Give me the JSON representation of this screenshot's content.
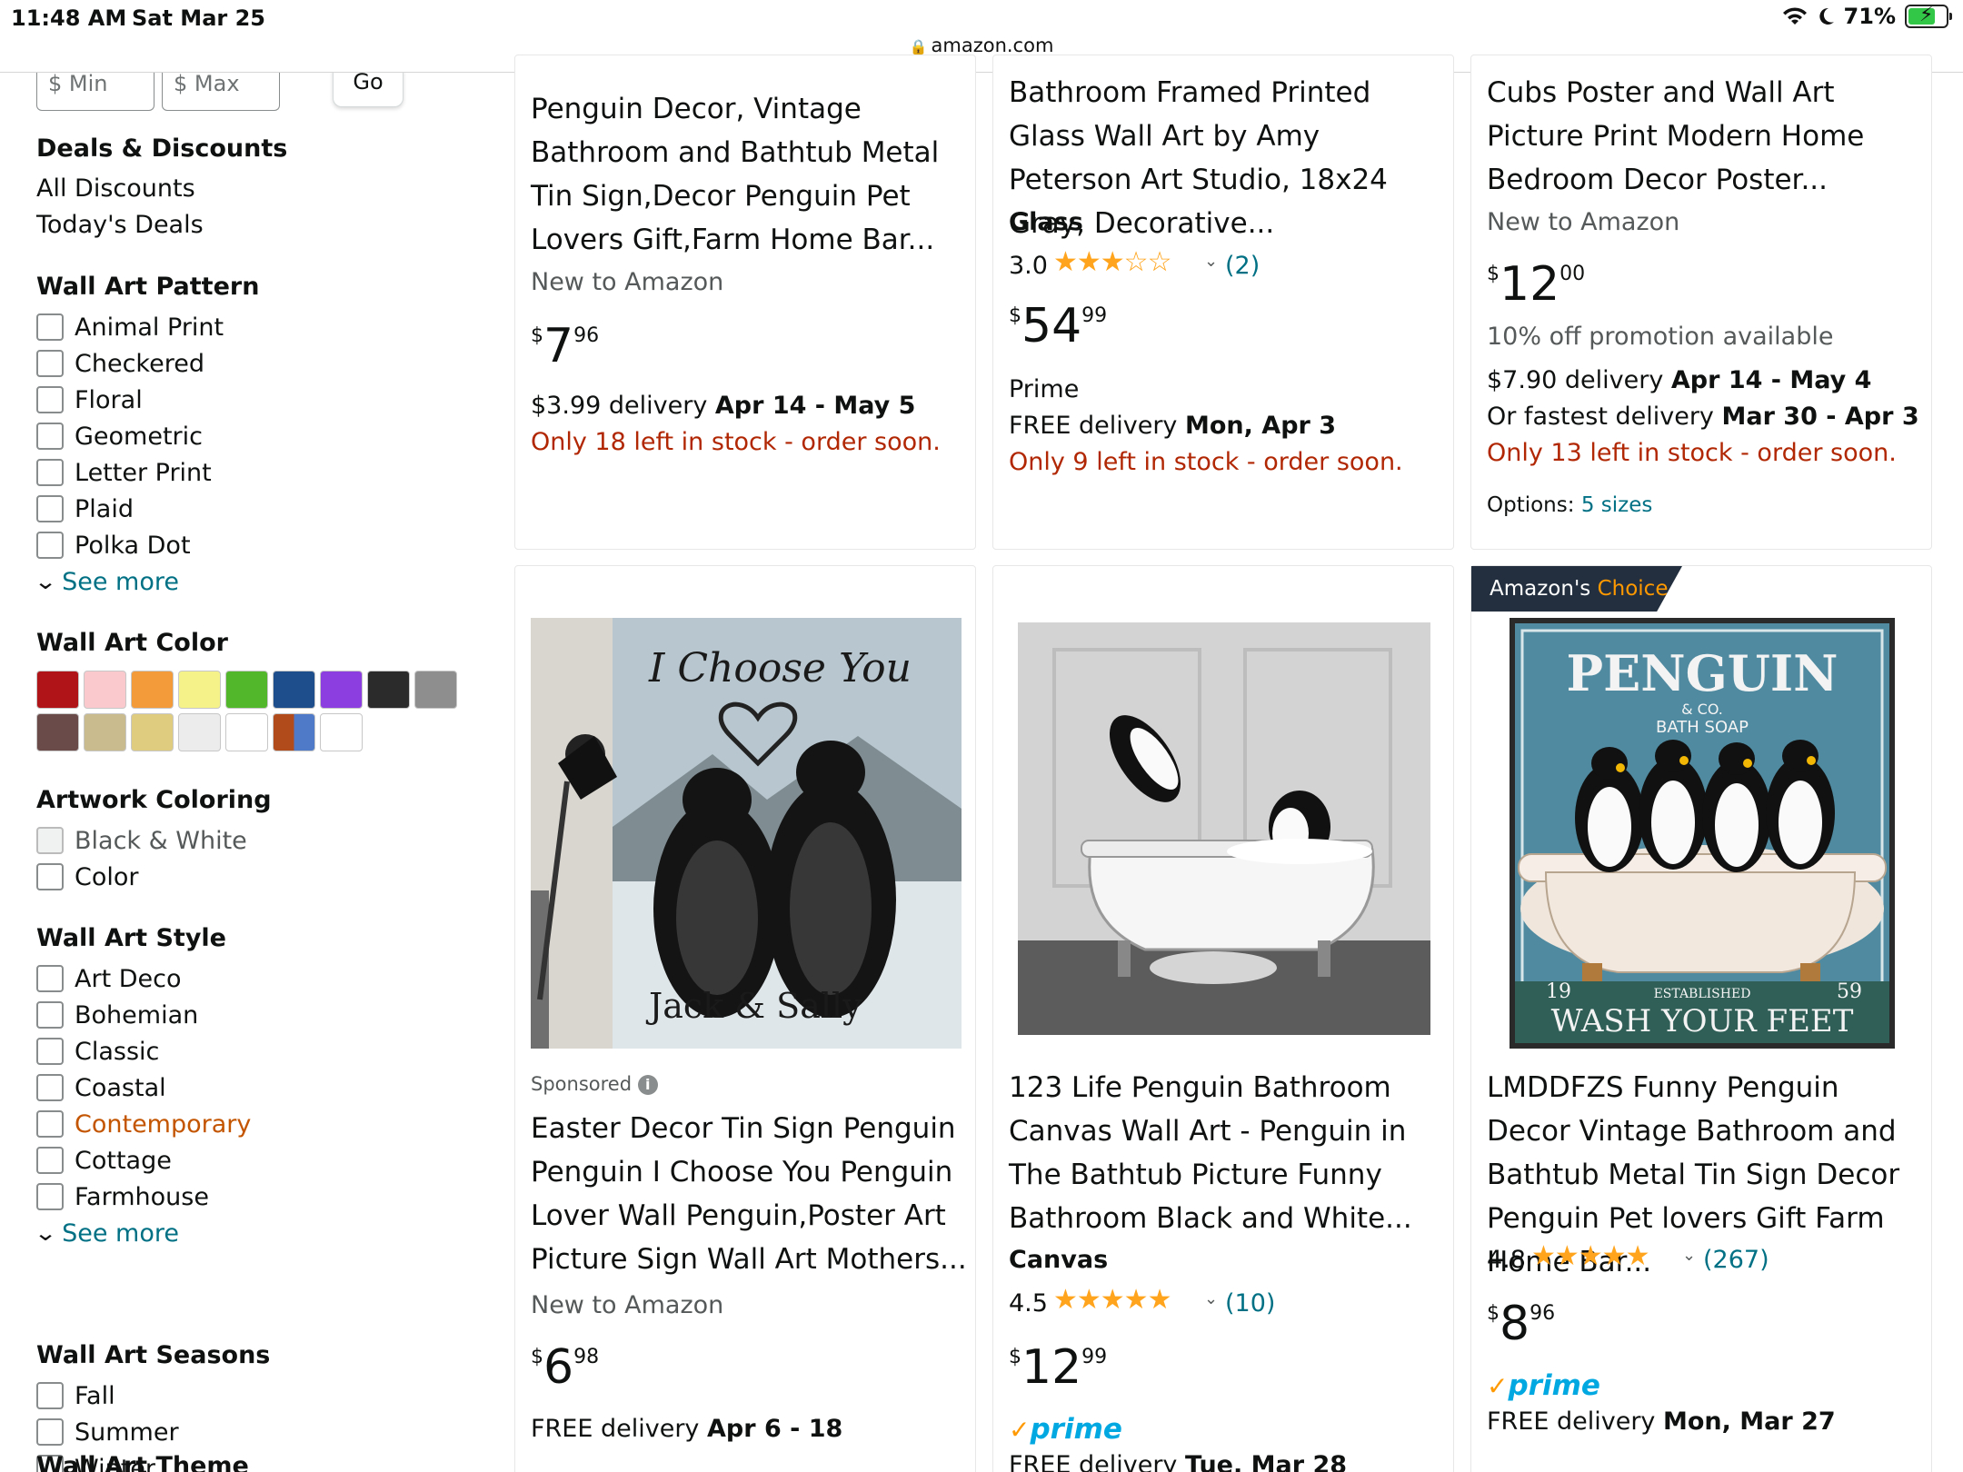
{
  "status_bar": {
    "time": "11:48 AM",
    "date": "Sat Mar 25",
    "battery": "71%",
    "url": "amazon.com"
  },
  "sidebar": {
    "price": {
      "min_placeholder": "$ Min",
      "max_placeholder": "$ Max",
      "go": "Go"
    },
    "deals": {
      "title": "Deals & Discounts",
      "items": [
        "All Discounts",
        "Today's Deals"
      ]
    },
    "pattern": {
      "title": "Wall Art Pattern",
      "items": [
        "Animal Print",
        "Checkered",
        "Floral",
        "Geometric",
        "Letter Print",
        "Plaid",
        "Polka Dot"
      ],
      "see_more": "See more"
    },
    "color": {
      "title": "Wall Art Color",
      "swatches": [
        "#b01318",
        "#f9c9cd",
        "#f39a3b",
        "#f5f28a",
        "#52b72a",
        "#1f4e8c",
        "#8c3ee0",
        "#2b2b2b",
        "#8e8e8e",
        "#6b4a4a",
        "#c9bb8e",
        "#dfcc7f",
        "#ececec",
        "#ffffff",
        "multi",
        "#ffffff"
      ]
    },
    "coloring": {
      "title": "Artwork Coloring",
      "items": [
        "Black & White",
        "Color"
      ]
    },
    "style": {
      "title": "Wall Art Style",
      "items": [
        "Art Deco",
        "Bohemian",
        "Classic",
        "Coastal",
        "Contemporary",
        "Cottage",
        "Farmhouse"
      ],
      "see_more": "See more"
    },
    "seasons": {
      "title": "Wall Art Seasons",
      "items": [
        "Fall",
        "Summer",
        "Winter"
      ]
    },
    "theme": {
      "title": "Wall Art Theme"
    }
  },
  "products": {
    "p1": {
      "title": "Penguin Decor, Vintage Bathroom and Bathtub Metal Tin Sign,Decor Penguin Pet Lovers Gift,Farm Home Bar...",
      "new": "New to Amazon",
      "price_cur": "$",
      "price_whole": "7",
      "price_frac": "96",
      "delivery_prefix": "$3.99 delivery ",
      "delivery_date": "Apr 14 - May 5",
      "stock": "Only 18 left in stock - order soon."
    },
    "p2": {
      "title": "Bathroom Framed Printed Glass Wall Art by Amy Peterson Art Studio, 18x24 Gray, Decorative...",
      "format": "Glass",
      "rating": "3.0",
      "stars": "★★★☆☆",
      "reviews": "(2)",
      "price_cur": "$",
      "price_whole": "54",
      "price_frac": "99",
      "prime_text": "Prime",
      "delivery_prefix": "FREE delivery ",
      "delivery_date": "Mon, Apr 3",
      "stock": "Only 9 left in stock - order soon."
    },
    "p3": {
      "title": "Cubs Poster and Wall Art Picture Print Modern Home Bedroom Decor Poster...",
      "new": "New to Amazon",
      "price_cur": "$",
      "price_whole": "12",
      "price_frac": "00",
      "promo": "10% off promotion available",
      "delivery_prefix": "$7.90 delivery ",
      "delivery_date": "Apr 14 - May 4",
      "fastest_prefix": "Or fastest delivery ",
      "fastest_date": "Mar 30 - Apr 3",
      "stock": "Only 13 left in stock - order soon.",
      "options_label": "Options: ",
      "options_value": "5 sizes"
    },
    "p4": {
      "sponsored": "Sponsored",
      "image_title": "I Choose You",
      "image_footer": "Jack & Sally",
      "title": "Easter Decor Tin Sign Penguin Penguin I Choose You Penguin Lover Wall Penguin,Poster Art Picture Sign Wall Art Mothers...",
      "new": "New to Amazon",
      "price_cur": "$",
      "price_whole": "6",
      "price_frac": "98",
      "delivery_prefix": "FREE delivery ",
      "delivery_date": "Apr 6 - 18"
    },
    "p5": {
      "title": "123 Life Penguin Bathroom Canvas Wall Art - Penguin in The Bathtub Picture Funny Bathroom Black and White...",
      "format": "Canvas",
      "rating": "4.5",
      "stars": "★★★★★",
      "reviews": "(10)",
      "price_cur": "$",
      "price_whole": "12",
      "price_frac": "99",
      "prime": "prime",
      "delivery_prefix": "FREE delivery ",
      "delivery_date": "Tue, Mar 28"
    },
    "p6": {
      "badge_a": "Amazon's ",
      "badge_b": "Choice",
      "image_title": "PENGUIN",
      "image_sub": "& CO.",
      "image_sub2": "BATH SOAP",
      "image_year_left": "19",
      "image_year_right": "59",
      "image_est": "ESTABLISHED",
      "image_footer": "WASH YOUR FEET",
      "title": "LMDDFZS Funny Penguin Decor Vintage Bathroom and Bathtub Metal Tin Sign Decor Penguin Pet lovers Gift Farm Home Bar...",
      "rating": "4.8",
      "stars": "★★★★★",
      "reviews": "(267)",
      "price_cur": "$",
      "price_whole": "8",
      "price_frac": "96",
      "prime": "prime",
      "delivery_prefix": "FREE delivery ",
      "delivery_date": "Mon, Mar 27"
    }
  }
}
